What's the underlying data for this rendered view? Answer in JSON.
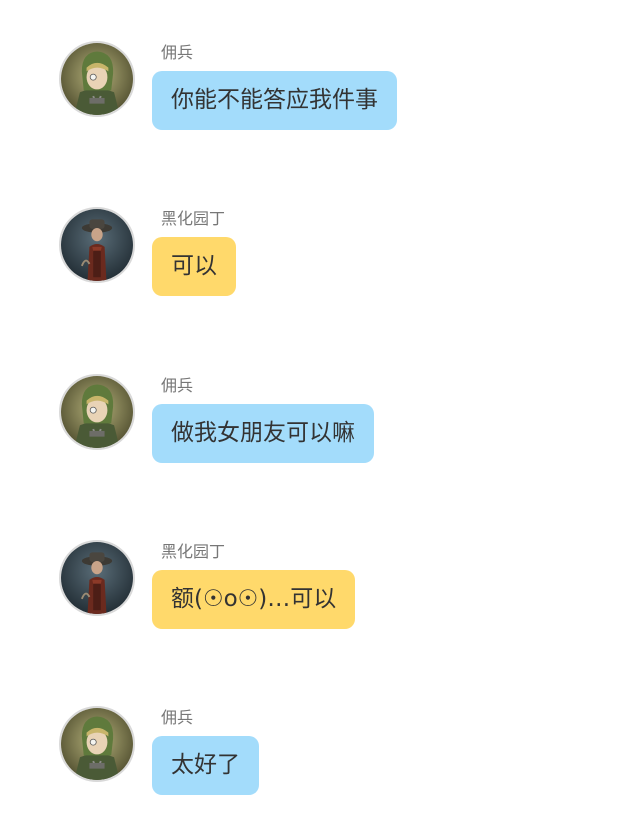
{
  "colors": {
    "mercenary_bubble": "#a3dcfb",
    "gardener_bubble": "#ffd96b",
    "name_text": "#777777",
    "bubble_text": "#333333"
  },
  "messages": [
    {
      "sender": "佣兵",
      "text": "你能不能答应我件事",
      "avatar": "mercenary-avatar",
      "bubble_color": "#a3dcfb"
    },
    {
      "sender": "黑化园丁",
      "text": "可以",
      "avatar": "gardener-avatar",
      "bubble_color": "#ffd96b"
    },
    {
      "sender": "佣兵",
      "text": "做我女朋友可以嘛",
      "avatar": "mercenary-avatar",
      "bubble_color": "#a3dcfb"
    },
    {
      "sender": "黑化园丁",
      "text": "额(☉o☉)…可以",
      "avatar": "gardener-avatar",
      "bubble_color": "#ffd96b"
    },
    {
      "sender": "佣兵",
      "text": "太好了",
      "avatar": "mercenary-avatar",
      "bubble_color": "#a3dcfb"
    }
  ]
}
